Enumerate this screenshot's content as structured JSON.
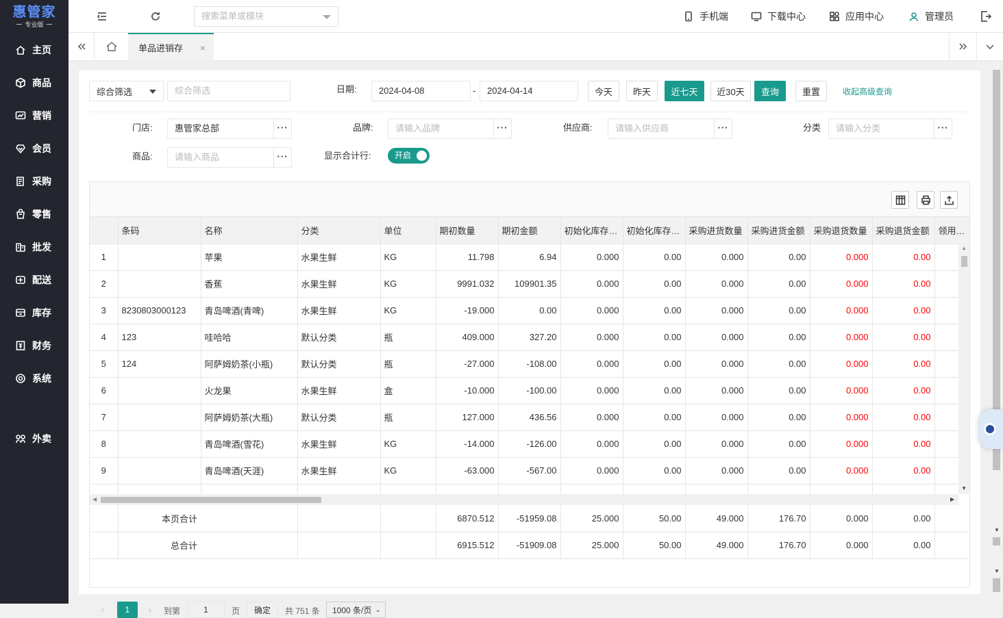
{
  "app": {
    "logo_main": "惠管家",
    "logo_sub": "专业版",
    "search_placeholder": "搜索菜单或模块",
    "top_links": {
      "mobile": "手机端",
      "download": "下载中心",
      "apps": "应用中心",
      "user": "管理员"
    },
    "accent_color": "#1a9a8c",
    "sidebar_bg": "#23262e"
  },
  "sidebar": {
    "items": [
      {
        "label": "主页",
        "icon": "home-icon"
      },
      {
        "label": "商品",
        "icon": "box-icon"
      },
      {
        "label": "营销",
        "icon": "chart-icon"
      },
      {
        "label": "会员",
        "icon": "diamond-icon"
      },
      {
        "label": "采购",
        "icon": "list-icon"
      },
      {
        "label": "零售",
        "icon": "bag-icon"
      },
      {
        "label": "批发",
        "icon": "building-icon"
      },
      {
        "label": "配送",
        "icon": "truck-icon"
      },
      {
        "label": "库存",
        "icon": "storage-icon"
      },
      {
        "label": "财务",
        "icon": "finance-icon"
      },
      {
        "label": "系统",
        "icon": "settings-icon"
      },
      {
        "label": "外卖",
        "icon": "takeout-icon"
      }
    ]
  },
  "tabs": {
    "active": "单品进销存"
  },
  "filters": {
    "combo_select": "综合筛选",
    "combo_placeholder": "综合筛选",
    "date_label": "日期:",
    "date_from": "2024-04-08",
    "date_sep": "-",
    "date_to": "2024-04-14",
    "btn_today": "今天",
    "btn_yesterday": "昨天",
    "btn_7days": "近七天",
    "btn_30days": "近30天",
    "btn_query": "查询",
    "btn_reset": "重置",
    "collapse_link": "收起高级查询",
    "store_label": "门店:",
    "store_value": "惠管家总部",
    "brand_label": "品牌:",
    "brand_placeholder": "请输入品牌",
    "supplier_label": "供应商:",
    "supplier_placeholder": "请输入供应商",
    "category_label": "分类",
    "category_placeholder": "请输入分类",
    "product_label": "商品:",
    "product_placeholder": "请输入商品",
    "total_row_label": "显示合计行:",
    "toggle_text": "开启",
    "toggle_on": true,
    "dots": "···"
  },
  "table": {
    "columns": [
      "",
      "条码",
      "名称",
      "分类",
      "单位",
      "期初数量",
      "期初金额",
      "初始化库存数量",
      "初始化库存金额",
      "采购进货数量",
      "采购进货金额",
      "采购退货数量",
      "采购退货金额",
      "领用入库"
    ],
    "rows": [
      [
        "1",
        "",
        "苹果",
        "水果生鲜",
        "KG",
        "11.798",
        "6.94",
        "0.000",
        "0.00",
        "0.000",
        "0.00",
        "0.000",
        "0.00"
      ],
      [
        "2",
        "",
        "香蕉",
        "水果生鲜",
        "KG",
        "9991.032",
        "109901.35",
        "0.000",
        "0.00",
        "0.000",
        "0.00",
        "0.000",
        "0.00"
      ],
      [
        "3",
        "8230803000123",
        "青岛啤酒(青啤)",
        "水果生鲜",
        "KG",
        "-19.000",
        "0.00",
        "0.000",
        "0.00",
        "0.000",
        "0.00",
        "0.000",
        "0.00"
      ],
      [
        "4",
        "123",
        "哇哈哈",
        "默认分类",
        "瓶",
        "409.000",
        "327.20",
        "0.000",
        "0.00",
        "0.000",
        "0.00",
        "0.000",
        "0.00"
      ],
      [
        "5",
        "124",
        "阿萨姆奶茶(小瓶)",
        "默认分类",
        "瓶",
        "-27.000",
        "-108.00",
        "0.000",
        "0.00",
        "0.000",
        "0.00",
        "0.000",
        "0.00"
      ],
      [
        "6",
        "",
        "火龙果",
        "水果生鲜",
        "盒",
        "-10.000",
        "-100.00",
        "0.000",
        "0.00",
        "0.000",
        "0.00",
        "0.000",
        "0.00"
      ],
      [
        "7",
        "",
        "阿萨姆奶茶(大瓶)",
        "默认分类",
        "瓶",
        "127.000",
        "436.56",
        "0.000",
        "0.00",
        "0.000",
        "0.00",
        "0.000",
        "0.00"
      ],
      [
        "8",
        "",
        "青岛啤酒(雪花)",
        "水果生鲜",
        "KG",
        "-14.000",
        "-126.00",
        "0.000",
        "0.00",
        "0.000",
        "0.00",
        "0.000",
        "0.00"
      ],
      [
        "9",
        "",
        "青岛啤酒(天涯)",
        "水果生鲜",
        "KG",
        "-63.000",
        "-567.00",
        "0.000",
        "0.00",
        "0.000",
        "0.00",
        "0.000",
        "0.00"
      ]
    ],
    "page_total": {
      "label": "本页合计",
      "values": [
        "6870.512",
        "-51959.08",
        "25.000",
        "50.00",
        "49.000",
        "176.70",
        "0.000",
        "0.00"
      ]
    },
    "grand_total": {
      "label": "总合计",
      "values": [
        "6915.512",
        "-51909.08",
        "25.000",
        "50.00",
        "49.000",
        "176.70",
        "0.000",
        "0.00"
      ]
    }
  },
  "pager": {
    "current": "1",
    "goto_label": "到第",
    "goto_value": "1",
    "page_unit": "页",
    "confirm": "确定",
    "total": "共 751 条",
    "page_size": "1000 条/页"
  }
}
